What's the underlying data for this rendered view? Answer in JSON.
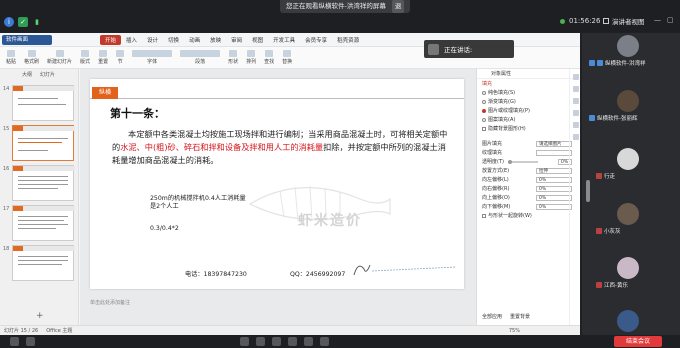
{
  "share_banner": {
    "text": "您正在观看纵横软件-洪湾祥的屏幕",
    "exit_label": "退"
  },
  "meeting": {
    "timer": "01:56:26",
    "view_label": "演讲者视图"
  },
  "wps": {
    "doc_tab": "软件画面",
    "menus": [
      "开始",
      "插入",
      "设计",
      "切换",
      "动画",
      "放映",
      "审阅",
      "视图",
      "开发工具",
      "会员专享",
      "稻壳资源"
    ],
    "active_menu": "开始",
    "ribbon": [
      "粘贴",
      "格式刷",
      "新建幻灯片",
      "版式",
      "重置",
      "节",
      "字体",
      "段落",
      "形状",
      "排列",
      "查找",
      "替换"
    ],
    "thumb_tabs": [
      "大纲",
      "幻灯片"
    ],
    "thumb_numbers": [
      "14",
      "15",
      "16",
      "17",
      "18"
    ],
    "notes_placeholder": "单击此处添加备注",
    "status_left": "幻灯片 15 / 26",
    "status_theme": "Office 主题",
    "zoom": "75%"
  },
  "speaking": {
    "label": "正在讲话:"
  },
  "slide": {
    "brand": "纵横",
    "heading": "第十一条：",
    "para_normal_1": "本定额中各类混凝土均按施工现场拌和进行编制；当采用商品混凝土时，可将相关定额中的",
    "para_red": "水泥、中(粗)砂、碎石和拌和设备及拌和用人工的消耗量",
    "para_normal_2": "扣除，并按定额中所列的混凝土消耗量增加商品混凝土的消耗。",
    "note_line1": "250m的机械搅拌机0.4人工消耗量",
    "note_line2": "是2个人工",
    "note_line3": "0.3/0.4*2",
    "watermark": "虾米造价",
    "phone": "电话：18397847230",
    "qq": "QQ：2456992097"
  },
  "props": {
    "header": "对象属性",
    "rows": [
      {
        "label": "填充",
        "value": ""
      },
      {
        "label": "纯色填充(S)",
        "value": ""
      },
      {
        "label": "渐变填充(G)",
        "value": ""
      },
      {
        "label": "图片或纹理填充(P)",
        "value": ""
      },
      {
        "label": "图案填充(A)",
        "value": ""
      },
      {
        "label": "隐藏背景图形(H)",
        "value": ""
      },
      {
        "label": "图片填充",
        "value": "请选择图片"
      },
      {
        "label": "纹理填充",
        "value": ""
      },
      {
        "label": "透明度(T)",
        "value": "0%"
      },
      {
        "label": "放置方式(E)",
        "value": "拉伸"
      },
      {
        "label": "向左偏移(L)",
        "value": "0%"
      },
      {
        "label": "向右偏移(R)",
        "value": "0%"
      },
      {
        "label": "向上偏移(O)",
        "value": "0%"
      },
      {
        "label": "向下偏移(M)",
        "value": "0%"
      },
      {
        "label": "与形状一起旋转(W)",
        "value": ""
      }
    ],
    "apply_all": "全部应用",
    "reset": "重置背景"
  },
  "participants": [
    {
      "name": "纵横软件-洪湾祥",
      "avatar_color": "#7a7f88"
    },
    {
      "name": "纵横软件-张丽辉",
      "avatar_color": "#5a4a3c"
    },
    {
      "name": "行走",
      "avatar_color": "#d8d8d8"
    },
    {
      "name": "小灰灰",
      "avatar_color": "#6b5a4e"
    },
    {
      "name": "江西-黄乐",
      "avatar_color": "#c9b8c6"
    },
    {
      "name": "",
      "avatar_color": "#3a5b8a"
    }
  ],
  "bottom": {
    "end_label": "结束会议"
  }
}
